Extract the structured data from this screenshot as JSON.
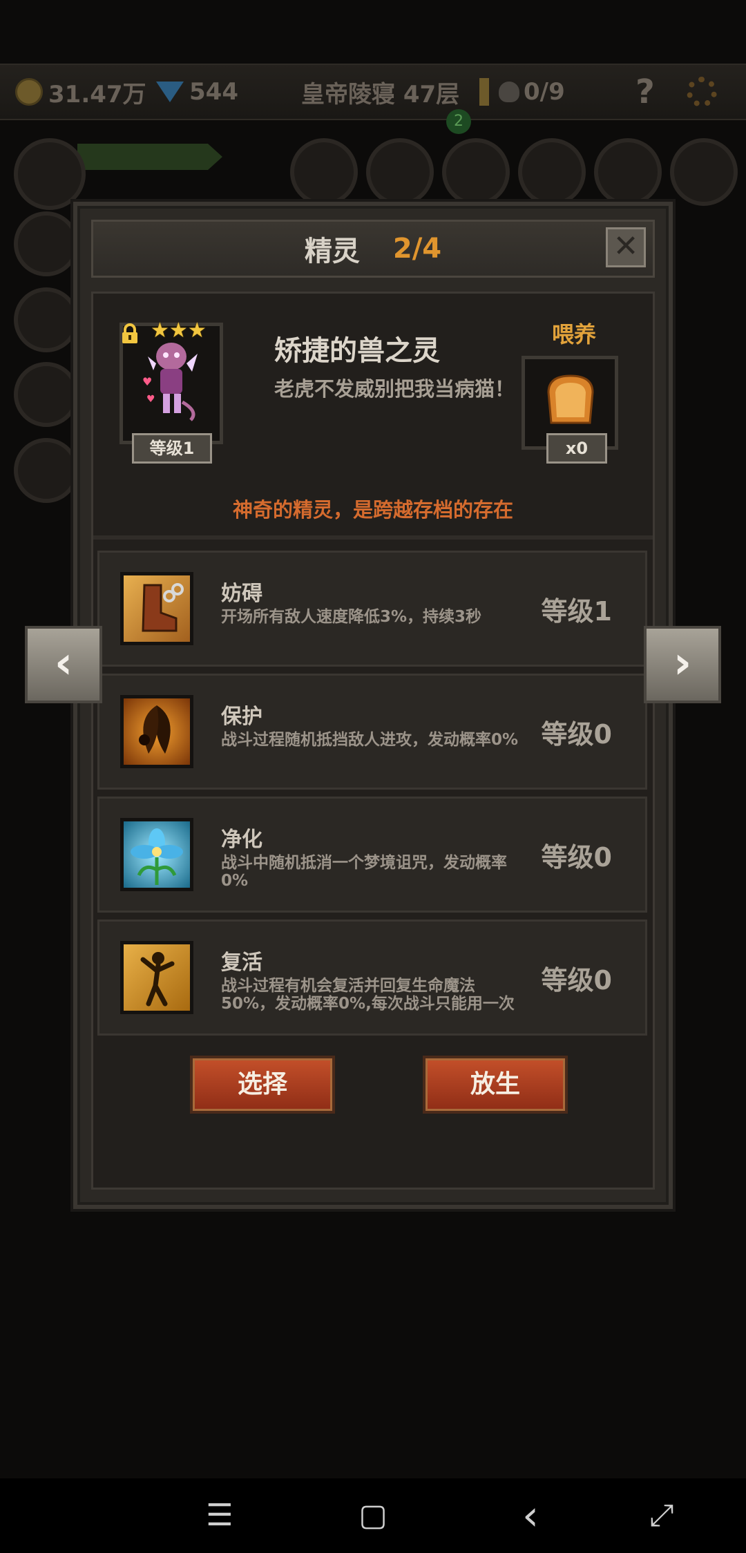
{
  "hud": {
    "gold": "31.47万",
    "gems": "544",
    "location": "皇帝陵寝 47层",
    "skull_count": "0/9",
    "help": "?",
    "badge": "2"
  },
  "dialog": {
    "title": "精灵",
    "count": "2/4",
    "close": "✕"
  },
  "spirit": {
    "stars": [
      "★",
      "★",
      "★"
    ],
    "level": "等级1",
    "name": "矫捷的兽之灵",
    "description": "老虎不发威别把我当病猫！",
    "feed_label": "喂养",
    "feed_count": "x0",
    "notice": "神奇的精灵，是跨越存档的存在"
  },
  "skills": [
    {
      "name": "妨碍",
      "desc": "开场所有敌人速度降低3%，持续3秒",
      "level": "等级1",
      "icon": "chain-boot-icon"
    },
    {
      "name": "保护",
      "desc": "战斗过程随机抵挡敌人进攻，发动概率0%",
      "level": "等级0",
      "icon": "fairy-shield-icon"
    },
    {
      "name": "净化",
      "desc": "战斗中随机抵消一个梦境诅咒，发动概率0%",
      "level": "等级0",
      "icon": "blue-flower-icon"
    },
    {
      "name": "复活",
      "desc": "战斗过程有机会复活并回复生命魔法50%，发动概率0%,每次战斗只能用一次",
      "level": "等级0",
      "icon": "revive-figure-icon"
    }
  ],
  "buttons": {
    "select": "选择",
    "release": "放生"
  },
  "arrows": {
    "prev": "‹",
    "next": "›"
  },
  "nav": {
    "menu": "☰",
    "home": "▢",
    "back": "‹",
    "expand": "⤢"
  },
  "colors": {
    "accent": "#e0952e",
    "notice": "#d56b2e",
    "button": "#b2411f"
  }
}
